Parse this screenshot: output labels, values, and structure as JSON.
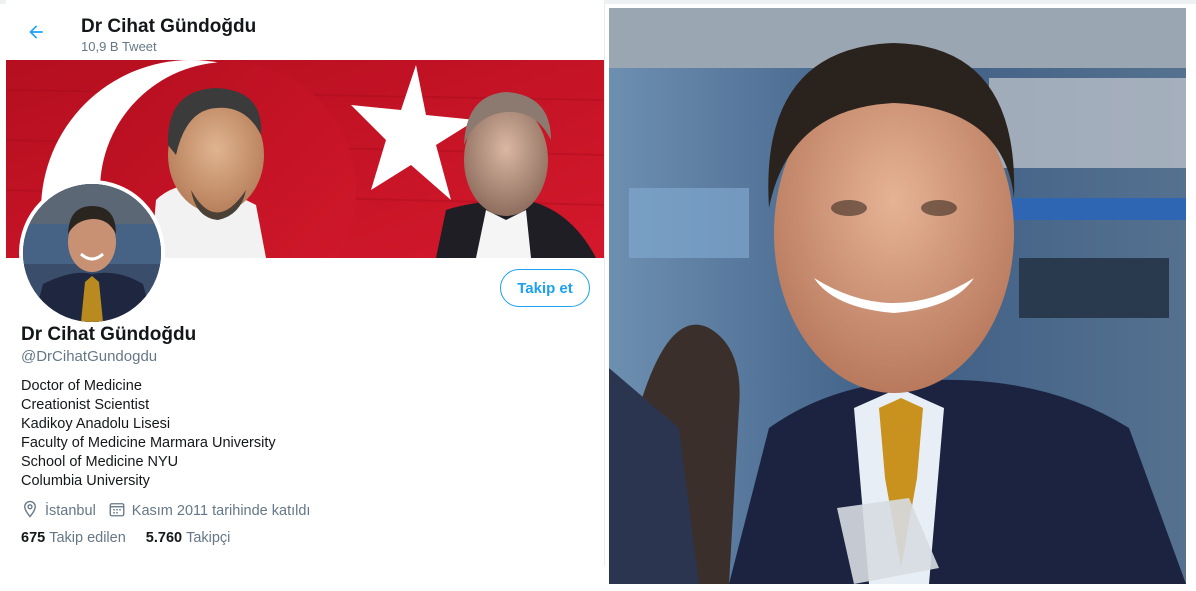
{
  "header": {
    "title": "Dr Cihat Gündoğdu",
    "tweet_count": "10,9 B Tweet"
  },
  "profile": {
    "display_name": "Dr Cihat Gündoğdu",
    "handle": "@DrCihatGundogdu",
    "follow_label": "Takip et",
    "bio_lines": [
      "Doctor of Medicine",
      "Creationist Scientist",
      "Kadikoy Anadolu Lisesi",
      "Faculty of Medicine Marmara University",
      "School of Medicine NYU",
      "Columbia University"
    ],
    "location": "İstanbul",
    "joined": "Kasım 2011 tarihinde katıldı",
    "following_count": "675",
    "following_label": "Takip edilen",
    "followers_count": "5.760",
    "followers_label": "Takipçi"
  },
  "icons": {
    "back": "arrow-left-icon",
    "location": "map-pin-icon",
    "calendar": "calendar-icon"
  },
  "colors": {
    "accent": "#1da1f2",
    "text": "#14171a",
    "muted": "#657786",
    "flag_red": "#c8102e"
  }
}
